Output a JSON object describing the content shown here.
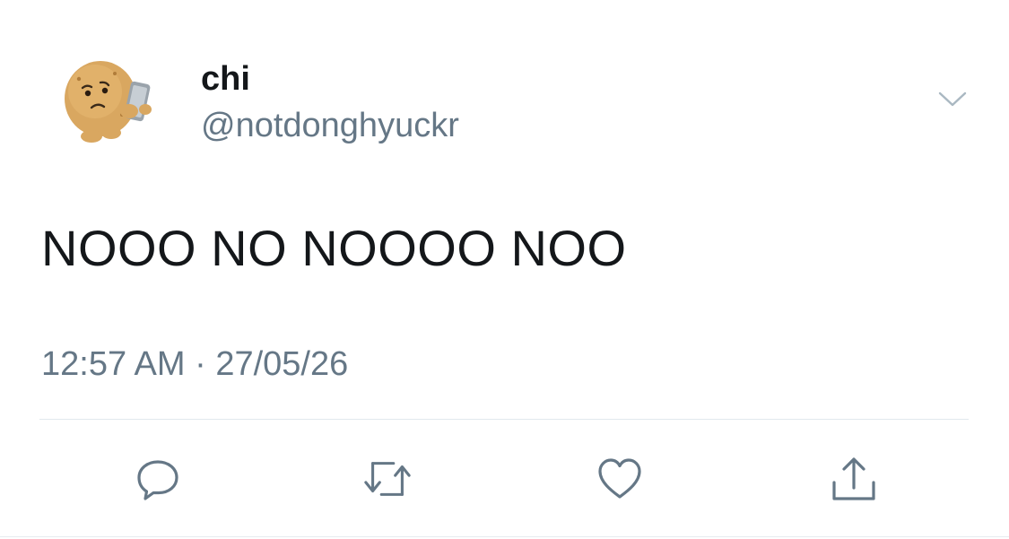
{
  "author": {
    "display_name": "chi",
    "handle": "@notdonghyuckr",
    "avatar": "potato-emoji-holding-phone"
  },
  "tweet": {
    "text": "NOOO NO NOOOO NOO",
    "timestamp": "12:57 AM · 27/05/26"
  },
  "actions": [
    {
      "name": "reply",
      "icon": "reply-icon"
    },
    {
      "name": "retweet",
      "icon": "retweet-icon"
    },
    {
      "name": "like",
      "icon": "heart-icon"
    },
    {
      "name": "share",
      "icon": "share-icon"
    }
  ],
  "colors": {
    "text_primary": "#14171a",
    "text_secondary": "#657786",
    "icon": "#657786",
    "divider": "#e1e8ed"
  }
}
